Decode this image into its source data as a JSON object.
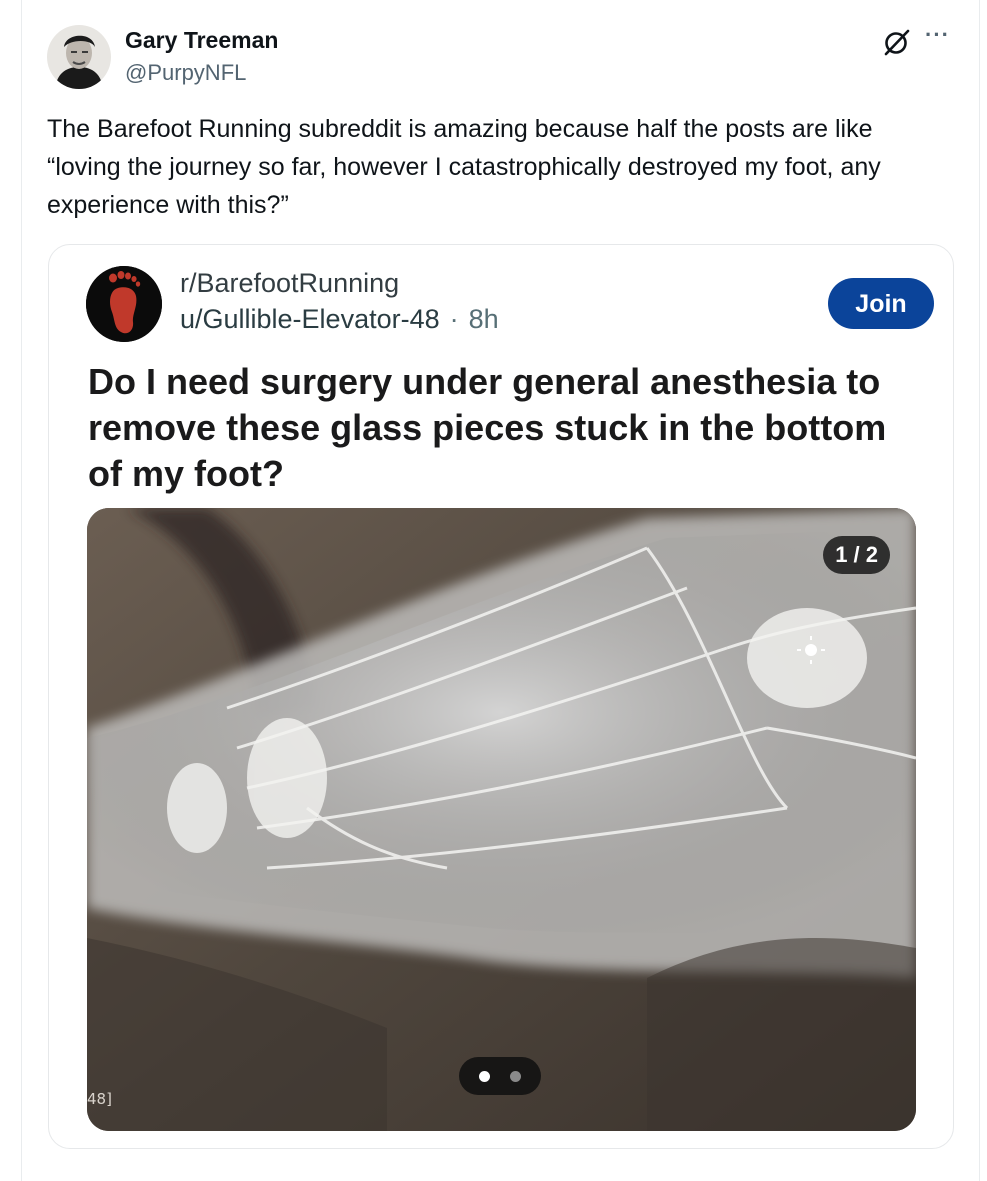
{
  "tweet": {
    "author_name": "Gary Treeman",
    "author_handle": "@PurpyNFL",
    "text": "The Barefoot Running subreddit is amazing because half the posts are like “loving the journey so far, however I catastrophically destroyed my foot, any experience with this?”",
    "icons": {
      "avatar": "author-avatar",
      "grok": "grok-icon",
      "more": "more-options-icon",
      "more_glyph": "···"
    }
  },
  "embedded_post": {
    "subreddit": "r/BarefootRunning",
    "username": "u/Gullible-Elevator-48",
    "separator": "·",
    "time_ago": "8h",
    "join_label": "Join",
    "title": "Do I need surgery under general anesthesia to remove these glass pieces stuck in the bottom of my foot?",
    "media": {
      "counter": "1 / 2",
      "film_label": "48]",
      "current_slide": 1,
      "total_slides": 2
    }
  },
  "colors": {
    "join_button": "#0b449a",
    "subreddit_icon_bg": "#0b0b0b",
    "subreddit_icon_foot": "#c0392b",
    "handle_gray": "#536471"
  }
}
